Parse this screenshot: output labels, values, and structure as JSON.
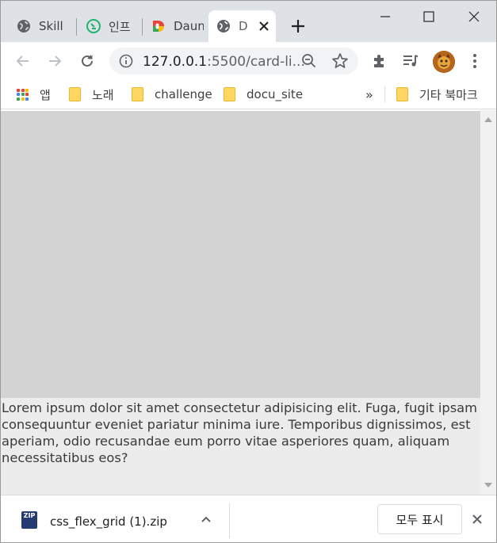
{
  "tabs": [
    {
      "title": "Skill",
      "icon": "globe-icon"
    },
    {
      "title": "인프",
      "icon": "inflearn-icon"
    },
    {
      "title": "Daun",
      "icon": "daum-icon"
    },
    {
      "title": "D",
      "icon": "globe-icon",
      "active": true
    }
  ],
  "window_controls": {
    "minimize": "minimize-icon",
    "maximize": "maximize-icon",
    "close": "close-icon"
  },
  "toolbar": {
    "url_host": "127.0.0.1",
    "url_rest": ":5500/card-li..."
  },
  "bookmarks": {
    "apps_label": "앱",
    "items": [
      "노래",
      "challenge",
      "docu_site"
    ],
    "overflow": "»",
    "other_label": "기타 북마크"
  },
  "page": {
    "card_text": "Lorem ipsum dolor sit amet consectetur adipisicing elit. Fuga, fugit ipsam consequuntur eveniet pariatur minima iure. Temporibus dignissimos, est aperiam, odio recusandae eum porro vitae asperiores quam, aliquam necessitatibus eos?"
  },
  "downloads": {
    "file_name": "css_flex_grid (1).zip",
    "file_badge": "ZIP",
    "show_all_label": "모두 표시"
  },
  "colors": {
    "tabstrip": "#dee1e6",
    "card_image": "#d3d3d3",
    "card_body": "#ececec",
    "folder": "#fdd663"
  }
}
